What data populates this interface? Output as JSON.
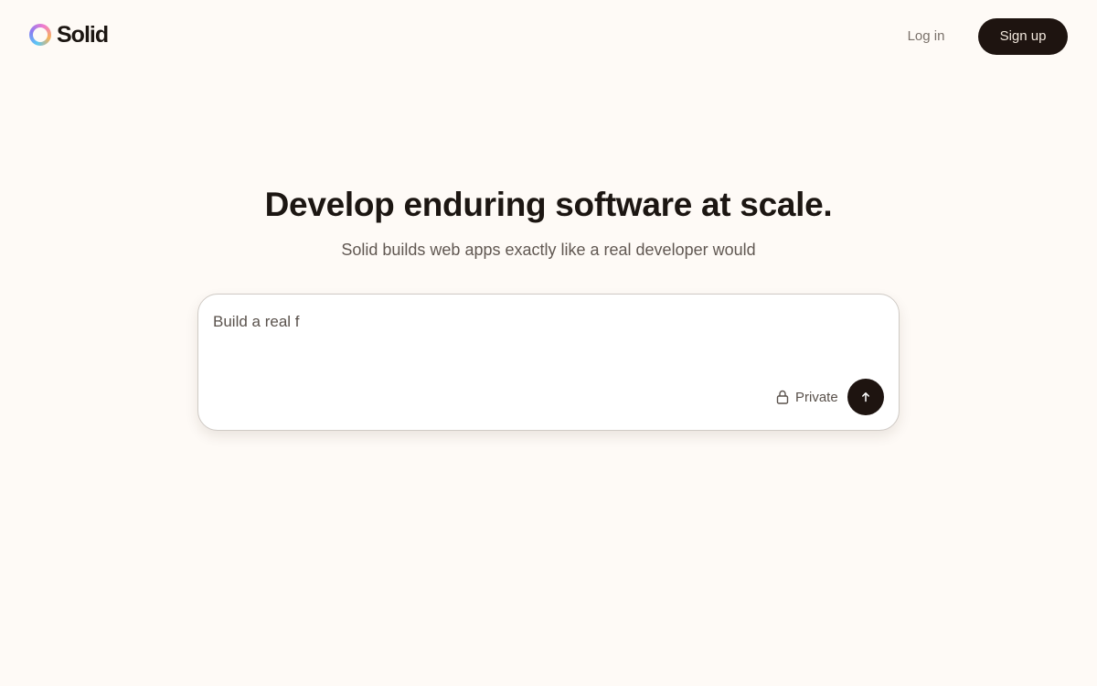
{
  "header": {
    "brand_name": "Solid",
    "login_label": "Log in",
    "signup_label": "Sign up"
  },
  "hero": {
    "title": "Develop enduring software at scale.",
    "subtitle": "Solid builds web apps exactly like a real developer would"
  },
  "prompt": {
    "value": "Build a real f",
    "placeholder": "",
    "privacy_label": "Private",
    "privacy_icon": "lock-icon",
    "send_icon": "arrow-up-icon"
  },
  "colors": {
    "background": "#fefaf6",
    "primary_button": "#1e1410",
    "text_dark": "#1c1612",
    "text_muted": "#615852"
  }
}
